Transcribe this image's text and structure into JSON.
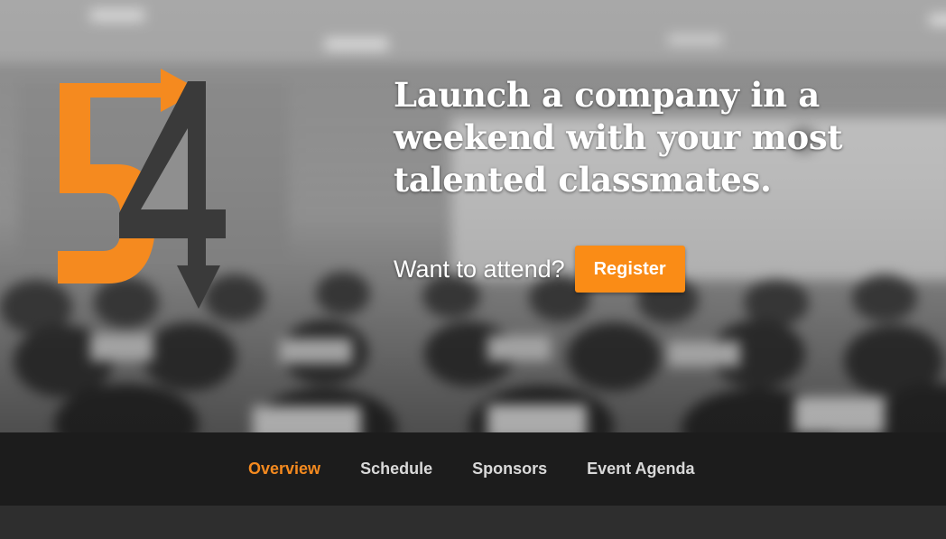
{
  "hero": {
    "headline": "Launch a company in a weekend with your most talented classmates.",
    "cta_text": "Want to attend?",
    "register_label": "Register"
  },
  "logo": {
    "name": "54-logo",
    "orange": "#f58a1f",
    "dark": "#3a3a3a"
  },
  "nav": {
    "items": [
      {
        "label": "Overview",
        "active": true
      },
      {
        "label": "Schedule",
        "active": false
      },
      {
        "label": "Sponsors",
        "active": false
      },
      {
        "label": "Event Agenda",
        "active": false
      }
    ]
  },
  "colors": {
    "accent": "#fa8c16",
    "nav_bg": "#1c1c1c",
    "nav_text": "#d9d9d9",
    "nav_active": "#f58a1f"
  }
}
